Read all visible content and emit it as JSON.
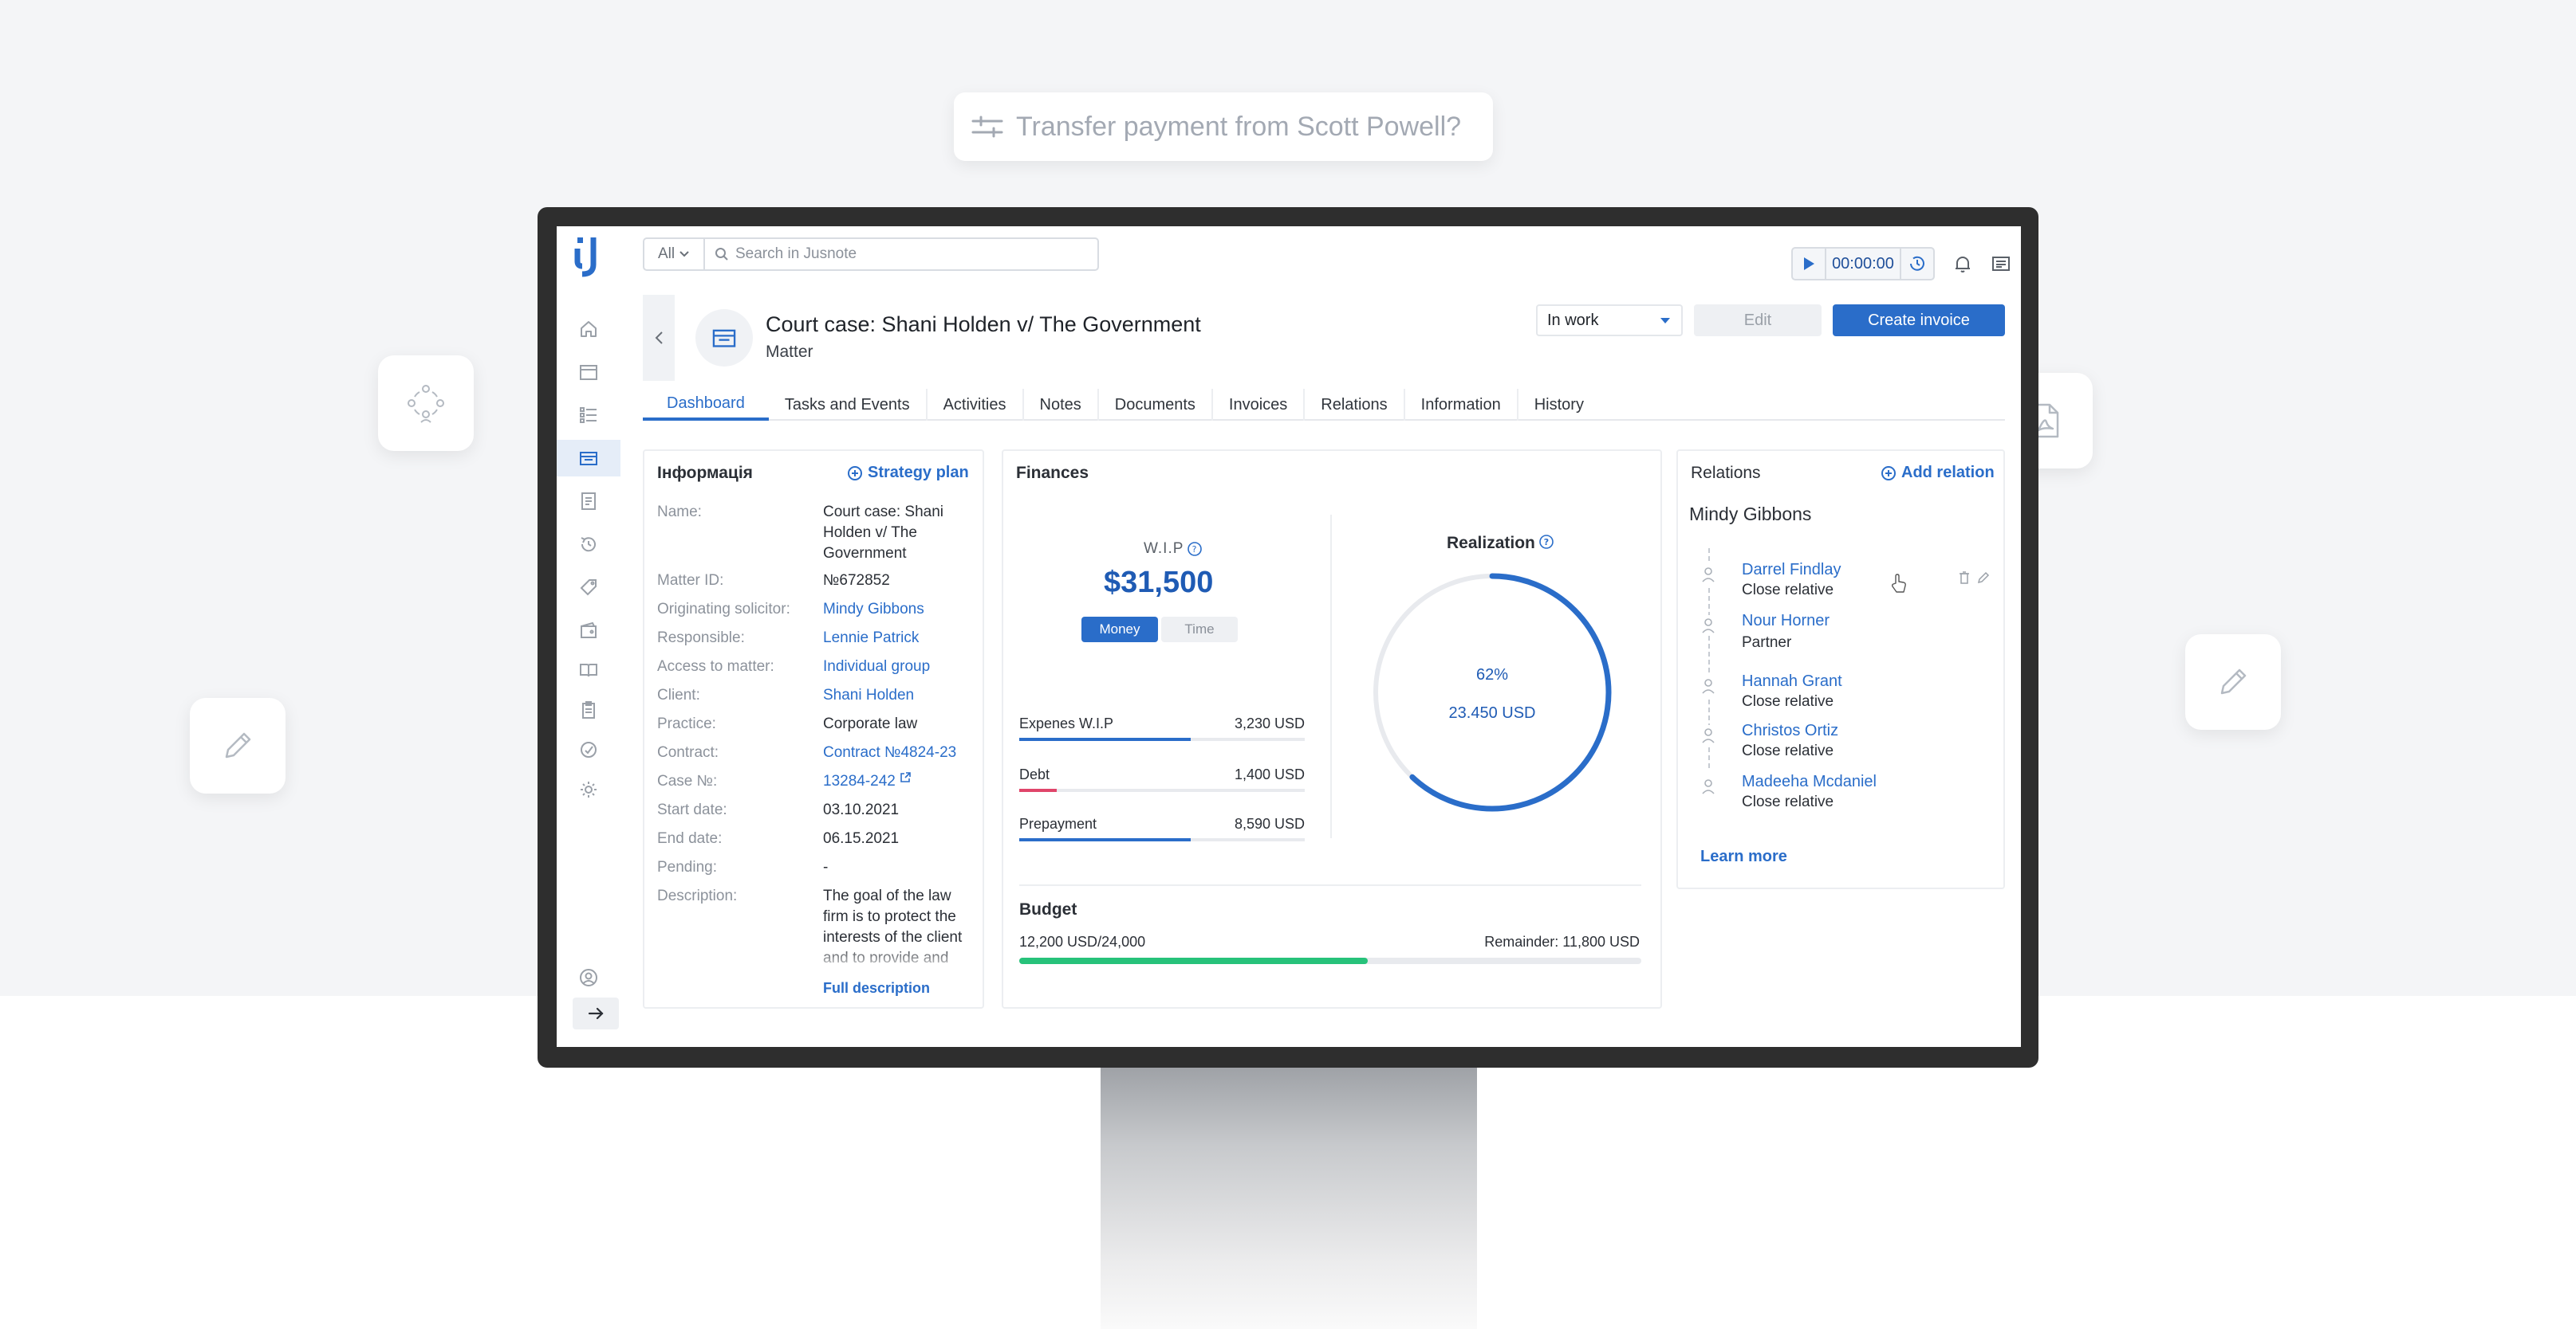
{
  "hint": {
    "text": "Transfer payment from Scott Powell?"
  },
  "search": {
    "scope": "All",
    "placeholder": "Search in Jusnote"
  },
  "timer": {
    "value": "00:00:00"
  },
  "matter": {
    "title": "Court case: Shani Holden v/ The Government",
    "type": "Matter",
    "status": "In work",
    "edit_label": "Edit",
    "create_invoice_label": "Create invoice"
  },
  "tabs": [
    "Dashboard",
    "Tasks and Events",
    "Activities",
    "Notes",
    "Documents",
    "Invoices",
    "Relations",
    "Information",
    "History"
  ],
  "info": {
    "title": "Інформація",
    "strategy_label": "Strategy plan",
    "rows": [
      {
        "label": "Name:",
        "value": "Court case: Shani Holden v/ The Government"
      },
      {
        "label": "Matter ID:",
        "value": "№672852"
      },
      {
        "label": "Originating solicitor:",
        "value": "Mindy Gibbons"
      },
      {
        "label": "Responsible:",
        "value": "Lennie Patrick"
      },
      {
        "label": "Access to matter:",
        "value": "Individual group"
      },
      {
        "label": "Client:",
        "value": "Shani Holden"
      },
      {
        "label": "Practice:",
        "value": "Corporate law"
      },
      {
        "label": "Contract:",
        "value": "Contract №4824-23"
      },
      {
        "label": "Case №:",
        "value": "13284-242"
      },
      {
        "label": "Start date:",
        "value": "03.10.2021"
      },
      {
        "label": "End date:",
        "value": "06.15.2021"
      },
      {
        "label": "Pending:",
        "value": "-"
      },
      {
        "label": "Description:",
        "value": "The goal of the law firm is to protect the interests of the client and to provide and"
      }
    ],
    "full_description_label": "Full description"
  },
  "finances": {
    "title": "Finances",
    "wip_label": "W.I.P",
    "wip_value": "$31,500",
    "toggle": {
      "money": "Money",
      "time": "Time"
    },
    "rows": [
      {
        "label": "Expenes W.I.P",
        "value": "3,230 USD",
        "progress": 0.6,
        "color": "#2a6dc9"
      },
      {
        "label": "Debt",
        "value": "1,400 USD",
        "progress": 0.13,
        "color": "#e0456a"
      },
      {
        "label": "Prepayment",
        "value": "8,590 USD",
        "progress": 0.6,
        "color": "#2a6dc9"
      }
    ],
    "realization_label": "Realization",
    "realization_pct": "62%",
    "realization_amount": "23.450 USD",
    "realization_fraction": 0.62,
    "budget": {
      "title": "Budget",
      "used": "12,200 USD",
      "total": "/24,000",
      "remainder_label": "Remainder:",
      "remainder_value": "11,800 USD",
      "progress": 0.56
    }
  },
  "relations": {
    "title": "Relations",
    "add_label": "Add relation",
    "owner": "Mindy Gibbons",
    "items": [
      {
        "name": "Darrel Findlay",
        "role": "Close relative"
      },
      {
        "name": "Nour Horner",
        "role": "Partner"
      },
      {
        "name": "Hannah Grant",
        "role": "Close relative"
      },
      {
        "name": "Christos Ortiz",
        "role": "Close relative"
      },
      {
        "name": "Madeeha Mcdaniel",
        "role": "Close relative"
      }
    ],
    "learn_more": "Learn more"
  },
  "colors": {
    "accent": "#2a6dc9",
    "success": "#27c27a",
    "danger": "#e0456a"
  }
}
